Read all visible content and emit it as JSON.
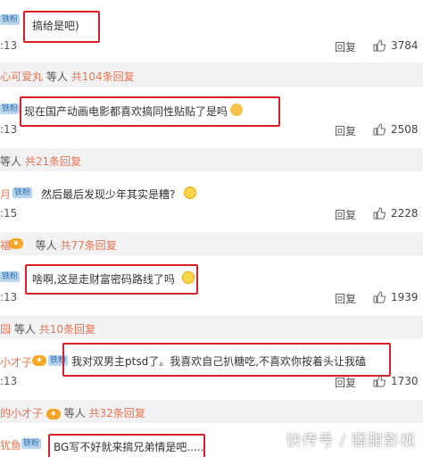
{
  "comments": [
    {
      "name": "",
      "badge": "铁粉",
      "text": "搞给是吧)",
      "time": ":13",
      "reply": "回复",
      "likes": "3784"
    },
    {
      "name": "",
      "badge": "铁粉",
      "text": "现在国产动画电影都喜欢搞同性贴贴了是吗",
      "time": ":13",
      "reply": "回复",
      "likes": "2508"
    },
    {
      "name": "月",
      "badge": "铁粉",
      "text": "然后最后发现少年其实是糟?",
      "time": ":15",
      "reply": "回复",
      "likes": "2228"
    },
    {
      "name": "",
      "badge": "铁粉",
      "text": "啥啊,这是走财富密码路线了吗",
      "time": ":13",
      "reply": "回复",
      "likes": "1939"
    },
    {
      "name": "小才子",
      "badge": "铁粉",
      "text": "我对双男主ptsd了。我喜欢自己扒糖吃,不喜欢你按着头让我磕",
      "time": ":13",
      "reply": "回复",
      "likes": "1730"
    },
    {
      "name": "犹鱼",
      "badge": "铁粉",
      "text": "BG写不好就来搞兄弟情是吧.....",
      "time": "",
      "reply": "",
      "likes": ""
    }
  ],
  "reply_summaries": [
    {
      "name": "心可爱丸",
      "mid": "等人",
      "count": "共104条回复"
    },
    {
      "name": "",
      "mid": "等人",
      "count": "共21条回复"
    },
    {
      "name": "福",
      "mid": "等人",
      "count": "共77条回复"
    },
    {
      "name": "园",
      "mid": "等人",
      "count": "共10条回复"
    },
    {
      "name": "的小才子",
      "mid": "等人",
      "count": "共32条回复"
    }
  ],
  "watermark": "快传号 / 骚甜影视",
  "colors": {
    "highlight": "#d9202a",
    "name": "#eb7350",
    "badge_bg": "#b9d6ee",
    "summary_bg": "#f2f2f5"
  }
}
